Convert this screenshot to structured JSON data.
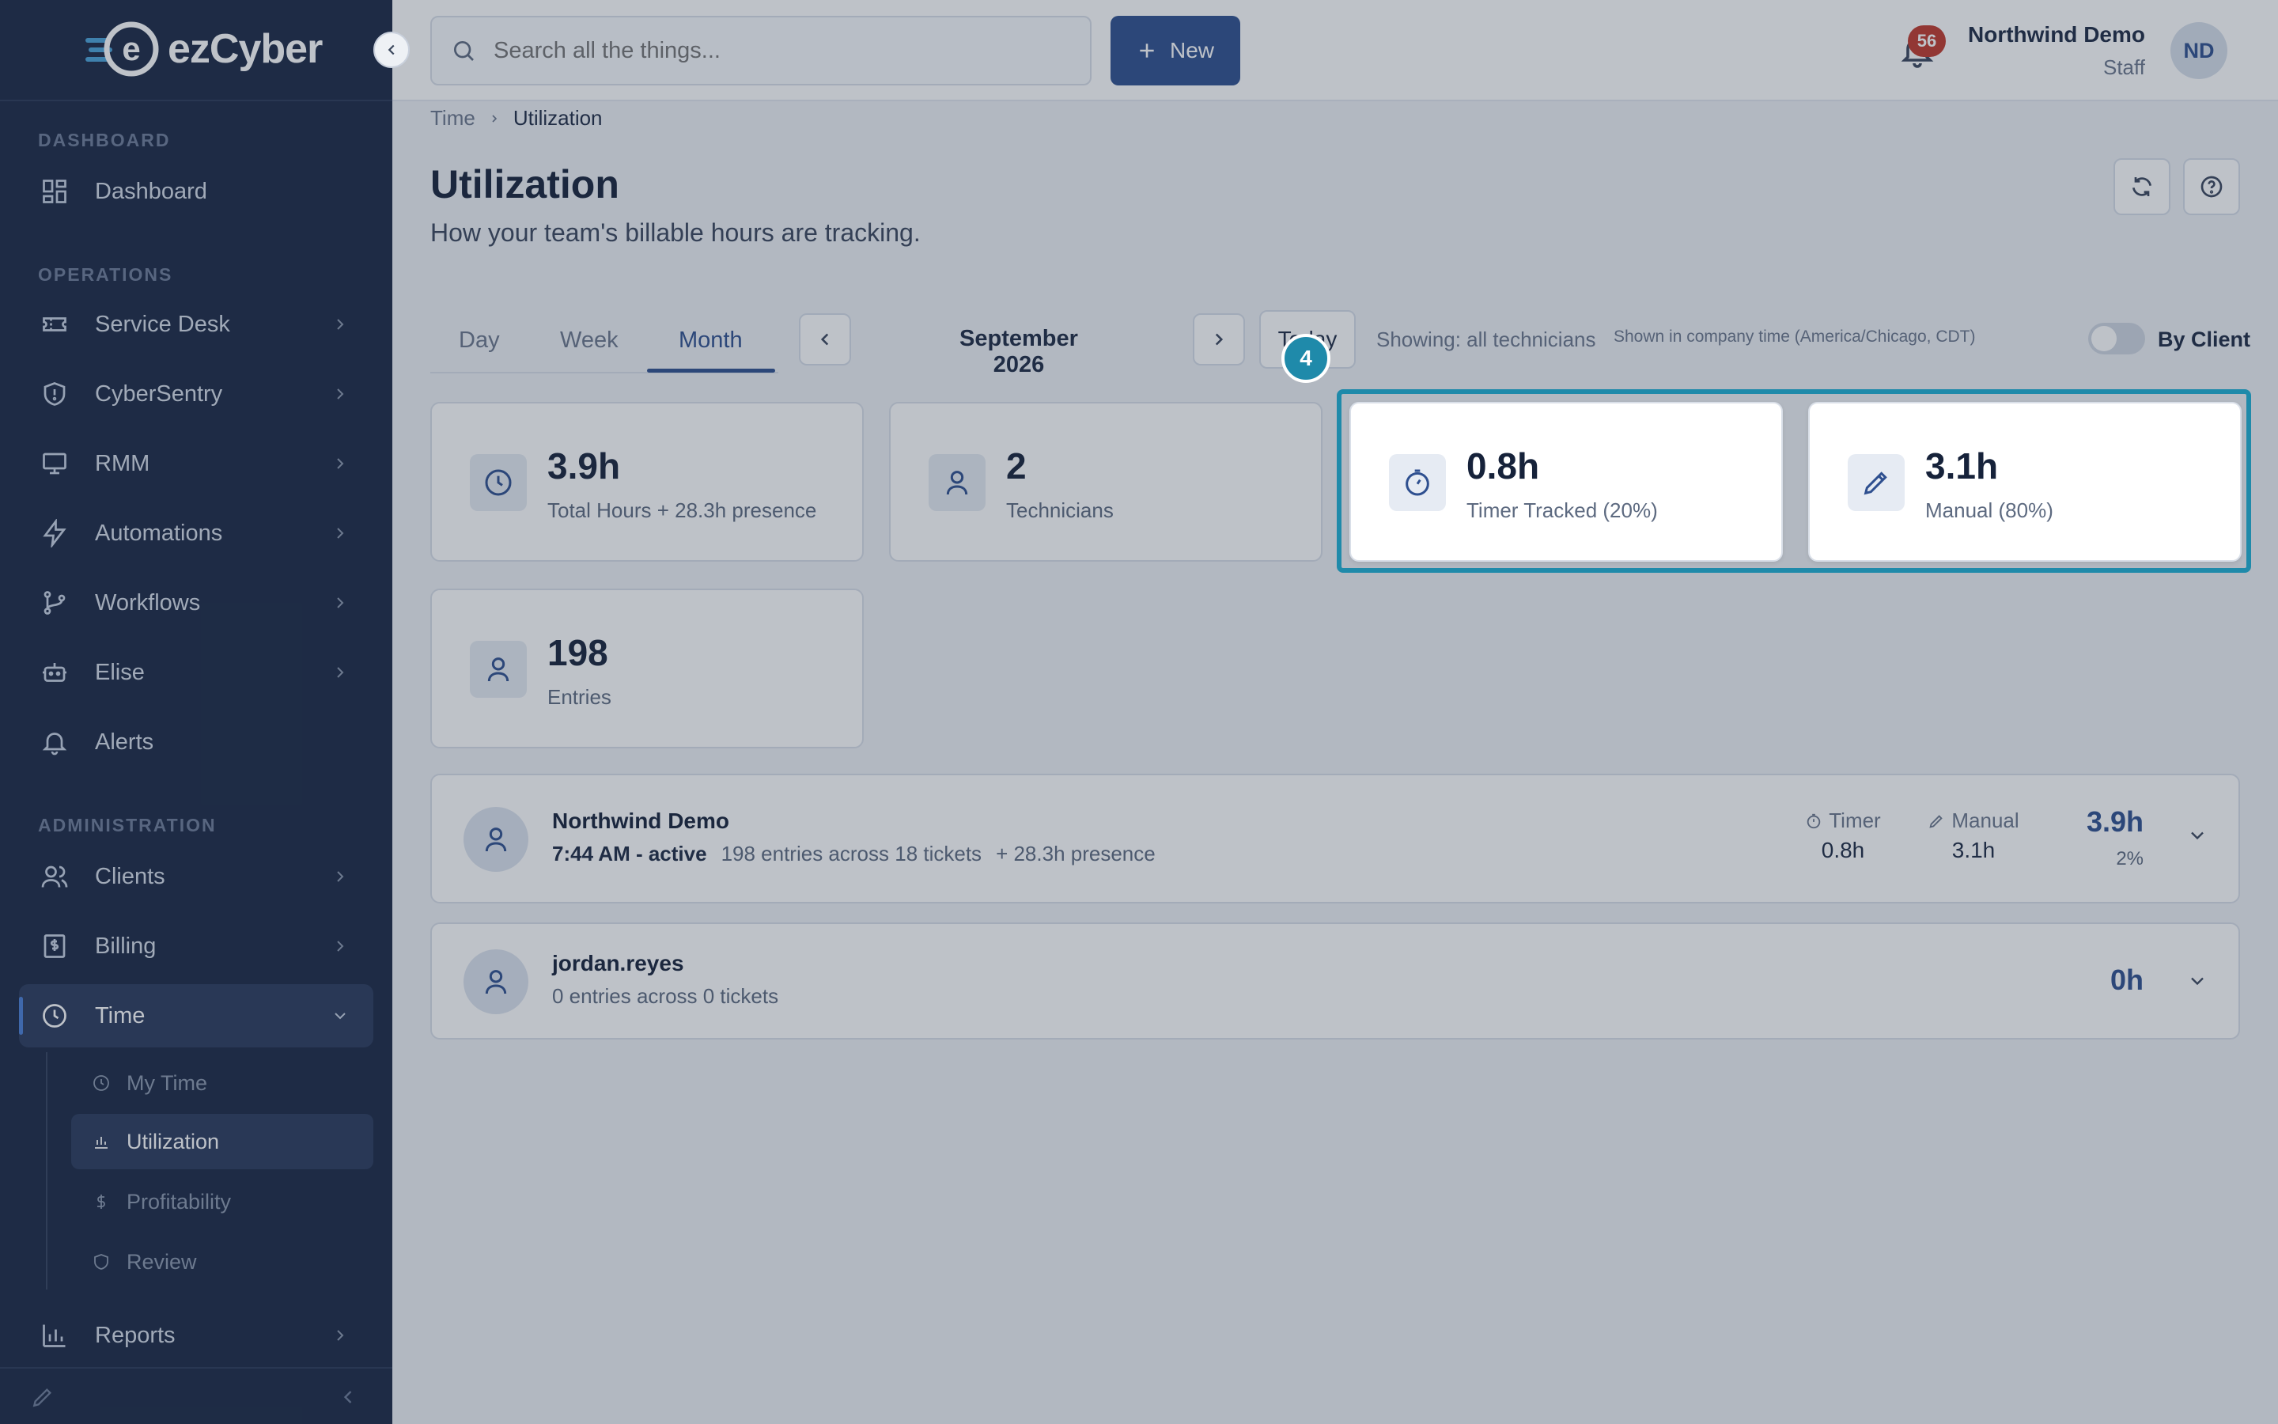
{
  "app": {
    "logo_text": "ezCyber"
  },
  "topbar": {
    "search_placeholder": "Search all the things...",
    "new_label": "New",
    "notification_count": "56",
    "user_name": "Northwind Demo",
    "user_role": "Staff",
    "avatar_initials": "ND"
  },
  "sidebar": {
    "sections": {
      "dashboard": "DASHBOARD",
      "operations": "OPERATIONS",
      "administration": "ADMINISTRATION"
    },
    "items": {
      "dashboard": "Dashboard",
      "service_desk": "Service Desk",
      "cybersentry": "CyberSentry",
      "rmm": "RMM",
      "automations": "Automations",
      "workflows": "Workflows",
      "elise": "Elise",
      "alerts": "Alerts",
      "clients": "Clients",
      "billing": "Billing",
      "time": "Time",
      "reports": "Reports"
    },
    "time_sub": {
      "my_time": "My Time",
      "utilization": "Utilization",
      "profitability": "Profitability",
      "review": "Review"
    }
  },
  "breadcrumb": {
    "parent": "Time",
    "current": "Utilization"
  },
  "page": {
    "title": "Utilization",
    "subtitle": "How your team's billable hours are tracking."
  },
  "period": {
    "tabs": [
      "Day",
      "Week",
      "Month"
    ],
    "active_tab": "Month",
    "label": "September 2026",
    "today_label": "Today",
    "showing": "Showing: all technicians",
    "timezone_note": "Shown in company time (America/Chicago, CDT)",
    "by_client_label": "By Client",
    "by_client_on": false
  },
  "summary_cards": {
    "total": {
      "value": "3.9h",
      "label": "Total Hours + 28.3h presence"
    },
    "technicians": {
      "value": "2",
      "label": "Technicians"
    },
    "timer": {
      "value": "0.8h",
      "label": "Timer Tracked (20%)"
    },
    "manual": {
      "value": "3.1h",
      "label": "Manual (80%)"
    },
    "entries": {
      "value": "198",
      "label": "Entries"
    }
  },
  "technicians": [
    {
      "name": "Northwind Demo",
      "status": "7:44 AM - active",
      "entries": "198 entries across 18 tickets",
      "presence": "+ 28.3h presence",
      "timer_label": "Timer",
      "timer_value": "0.8h",
      "manual_label": "Manual",
      "manual_value": "3.1h",
      "total": "3.9h",
      "percent": "2%"
    },
    {
      "name": "jordan.reyes",
      "entries": "0 entries across 0 tickets",
      "total": "0h"
    }
  ],
  "tutorial": {
    "step": "4"
  },
  "colors": {
    "sidebar_bg": "#1a2844",
    "accent": "#2e4f8f",
    "highlight": "#1f8aaa",
    "badge": "#c0392b"
  }
}
